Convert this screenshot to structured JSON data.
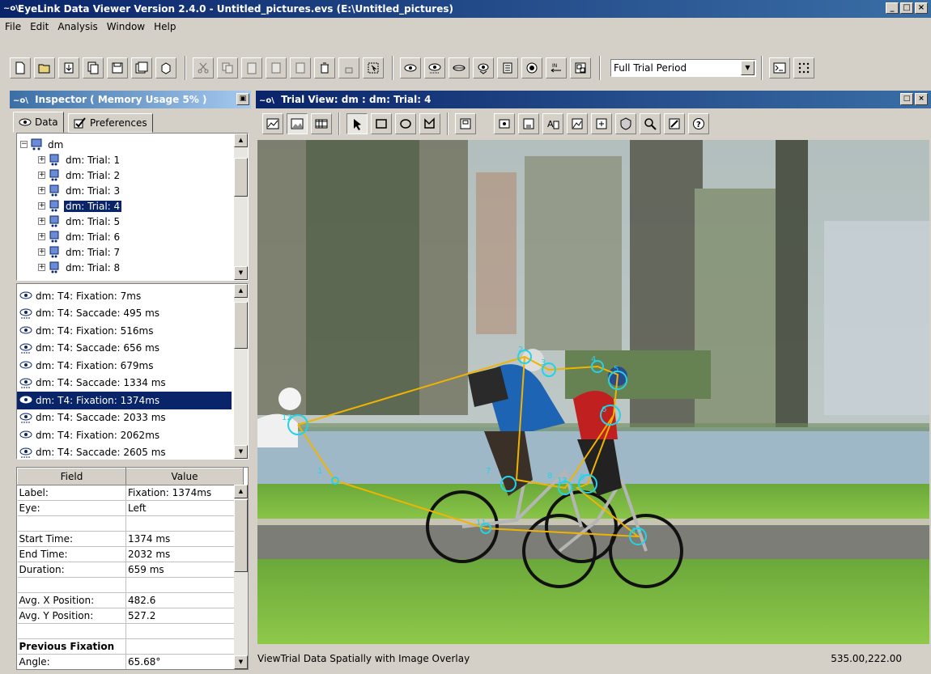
{
  "window": {
    "title": "EyeLink Data Viewer Version 2.4.0 - Untitled_pictures.evs (E:\\Untitled_pictures)",
    "app_logo": "~o\\",
    "controls": [
      "minimize-icon",
      "maximize-icon",
      "close-icon"
    ]
  },
  "menu": [
    "File",
    "Edit",
    "Analysis",
    "Window",
    "Help"
  ],
  "toolbar": {
    "period_selected": "Full Trial Period"
  },
  "inspector": {
    "title": "Inspector ( Memory Usage 5% )",
    "tabs": [
      {
        "label": "Data",
        "icon": "eye-icon",
        "active": true
      },
      {
        "label": "Preferences",
        "icon": "checkbox-icon",
        "active": false
      }
    ],
    "tree": {
      "root": "dm",
      "items": [
        "dm: Trial: 1",
        "dm: Trial: 2",
        "dm: Trial: 3",
        "dm: Trial: 4",
        "dm: Trial: 5",
        "dm: Trial: 6",
        "dm: Trial: 7",
        "dm: Trial: 8"
      ],
      "selected_index": 3
    },
    "events": {
      "items": [
        "dm: T4: Fixation: 7ms",
        "dm: T4: Saccade: 495 ms",
        "dm: T4: Fixation: 516ms",
        "dm: T4: Saccade: 656 ms",
        "dm: T4: Fixation: 679ms",
        "dm: T4: Saccade: 1334 ms",
        "dm: T4: Fixation: 1374ms",
        "dm: T4: Saccade: 2033 ms",
        "dm: T4: Fixation: 2062ms",
        "dm: T4: Saccade: 2605 ms"
      ],
      "selected_index": 6
    },
    "properties": {
      "headers": [
        "Field",
        "Value"
      ],
      "rows": [
        {
          "field": "Label:",
          "value": "Fixation: 1374ms"
        },
        {
          "field": "Eye:",
          "value": "Left"
        },
        {
          "field": "",
          "value": ""
        },
        {
          "field": "Start Time:",
          "value": "1374 ms"
        },
        {
          "field": "End Time:",
          "value": "2032 ms"
        },
        {
          "field": "Duration:",
          "value": "659 ms"
        },
        {
          "field": "",
          "value": ""
        },
        {
          "field": "Avg. X Position:",
          "value": "482.6"
        },
        {
          "field": "Avg. Y Position:",
          "value": "527.2"
        },
        {
          "field": "",
          "value": ""
        },
        {
          "field": "Previous Fixation",
          "value": "",
          "bold": true
        },
        {
          "field": "Angle:",
          "value": "65.68°"
        }
      ]
    }
  },
  "trial_view": {
    "title": "Trial View: dm : dm: Trial: 4",
    "status_message": "ViewTrial Data Spatially with Image Overlay",
    "coordinates": "535.00,222.00",
    "fixation_labels": [
      "1",
      "2",
      "3",
      "4",
      "5",
      "6",
      "7",
      "8",
      "9",
      "10",
      "11",
      "12",
      "13"
    ],
    "colors": {
      "scanpath": "#f0b400",
      "fixation": "#22d3e6"
    }
  }
}
